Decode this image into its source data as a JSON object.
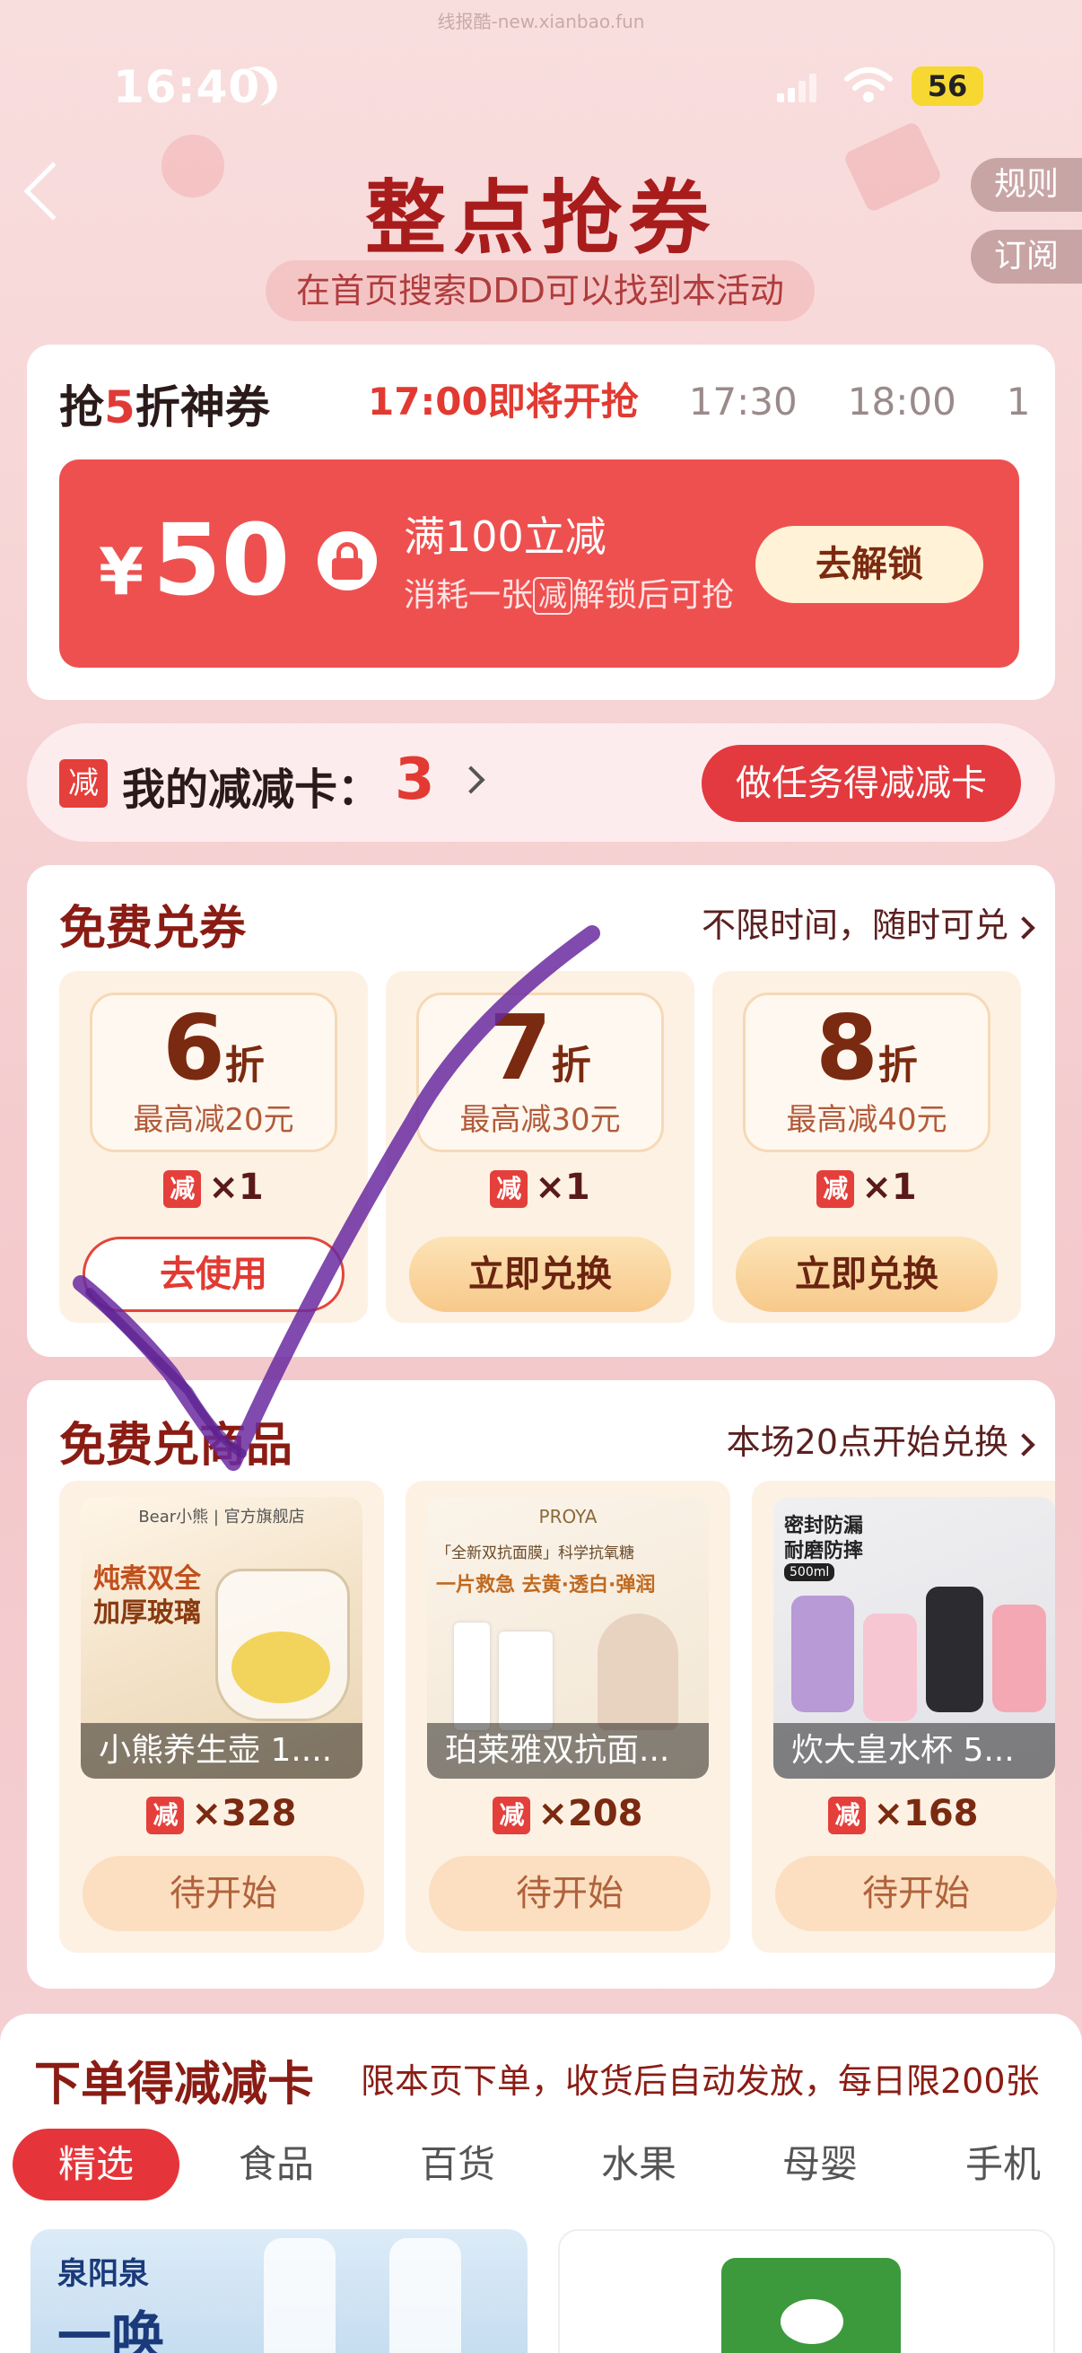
{
  "watermark": "线报酷-new.xianbao.fun",
  "status": {
    "time": "16:40",
    "battery": "56"
  },
  "header": {
    "title": "整点抢券",
    "rules": "规则",
    "subscribe": "订阅",
    "subtitle": "在首页搜索DDD可以找到本活动"
  },
  "flash": {
    "title_a": "抢",
    "title_b": "5",
    "title_c": "折神券",
    "slots": [
      {
        "label": "17:00即将开抢"
      },
      {
        "label": "17:30"
      },
      {
        "label": "18:00"
      },
      {
        "label": "1"
      }
    ],
    "coupon": {
      "currency": "¥",
      "amount": "50",
      "condition": "满100立减",
      "hint_a": "消耗一张",
      "hint_box": "减",
      "hint_b": "解锁后可抢",
      "unlock": "去解锁"
    }
  },
  "cards_bar": {
    "icon": "减",
    "label": "我的减减卡：",
    "count": "3",
    "task": "做任务得减减卡"
  },
  "free_coupons": {
    "title": "免费兑券",
    "link": "不限时间，随时可兑",
    "items": [
      {
        "disc": "6",
        "unit": "折",
        "max": "最高减20元",
        "need_icon": "减",
        "need": "×1",
        "btn": "去使用"
      },
      {
        "disc": "7",
        "unit": "折",
        "max": "最高减30元",
        "need_icon": "减",
        "need": "×1",
        "btn": "立即兑换"
      },
      {
        "disc": "8",
        "unit": "折",
        "max": "最高减40元",
        "need_icon": "减",
        "need": "×1",
        "btn": "立即兑换"
      }
    ]
  },
  "free_goods": {
    "title": "免费兑商品",
    "link": "本场20点开始兑换",
    "items": [
      {
        "name": "小熊养生壶 1....",
        "need_icon": "减",
        "need": "×328",
        "btn": "待开始",
        "img_text_a": "炖煮双全",
        "img_text_b": "加厚玻璃",
        "brand": "Bear小熊 | 官方旗舰店"
      },
      {
        "name": "珀莱雅双抗面...",
        "need_icon": "减",
        "need": "×208",
        "btn": "待开始",
        "img_text_a": "PROYA",
        "img_text_b": "一片救急 去黄·透白·弹润",
        "brand": "「全新双抗面膜」科学抗氧糖"
      },
      {
        "name": "炊大皇水杯 5...",
        "need_icon": "减",
        "need": "×168",
        "btn": "待开始",
        "img_text_a": "密封防漏",
        "img_text_b": "耐磨防摔",
        "brand": "500ml"
      }
    ]
  },
  "order_section": {
    "title": "下单得减减卡",
    "desc": "限本页下单，收货后自动发放，每日限200张",
    "categories": [
      {
        "label": "精选"
      },
      {
        "label": "食品"
      },
      {
        "label": "百货"
      },
      {
        "label": "水果"
      },
      {
        "label": "母婴"
      },
      {
        "label": "手机"
      }
    ],
    "product_brand": "泉阳泉",
    "product_text": "一唤"
  },
  "colors": {
    "accent": "#e23a32",
    "title": "#a81c1c",
    "coupon_bg": "#ee5050"
  }
}
